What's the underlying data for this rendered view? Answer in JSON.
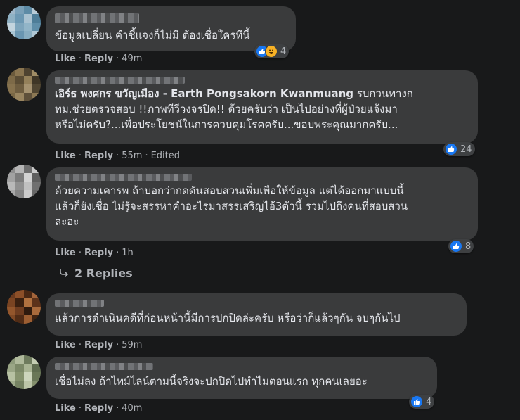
{
  "comments": [
    {
      "name": "",
      "text": "ข้อมูลเปลี่ยน คำชี้แจงก็ไม่มี ต้องเชื่อใครทีนี้",
      "like": "Like",
      "reply": "Reply",
      "time": "49m",
      "edited": "",
      "reactions": {
        "count": "4",
        "types": [
          "like",
          "haha"
        ]
      },
      "avatar_colors": [
        "#9fb7c9",
        "#7aa0b8",
        "#5d8ba6",
        "#b7cad6",
        "#8fb1c4",
        "#6c98b3",
        "#a9c2d1",
        "#4e7d98",
        "#c3d4de",
        "#7ea5bc",
        "#92b5c8",
        "#5f8ea9",
        "#aac5d4",
        "#6a96b1",
        "#88adc1",
        "#b0c8d6"
      ]
    },
    {
      "name_bold": "เอิร์ธ พงศกร ขวัญเมือง - Earth Pongsakorn Kwanmuang",
      "text_rest": " รบกวนทางก\nทม.ช่วยตรวจสอบ !!ภาพทีวีวงจรปิด!! ด้วยครับว่า เป็นไปอย่างที่ผู้ป่วยแจ้งมา\nหรือไม่ครับ?...เพื่อประโยชน์ในการควบคุมโรคครับ...ขอบพระคุณมากครับ...",
      "like": "Like",
      "reply": "Reply",
      "time": "55m",
      "edited": "Edited",
      "reactions": {
        "count": "24",
        "types": [
          "like"
        ]
      },
      "avatar_colors": [
        "#6b5a3c",
        "#8a7550",
        "#4f4330",
        "#a08c64",
        "#7d6a48",
        "#5b4d35",
        "#94805a",
        "#3f3626",
        "#86724e",
        "#6e5d40",
        "#a59270",
        "#514632",
        "#7a6846",
        "#998560",
        "#5e503a",
        "#8c7854"
      ]
    },
    {
      "name": "",
      "text": "ด้วยความเคารพ ถ้าบอกว่ากดดันสอบสวนเพิ่มเพื่อให้ข้อมูล แต่ได้ออกมาแบบนี้\nแล้วก็ยังเชื่อ ไม่รู้จะสรรหาคำอะไรมาสรรเสริญไอ้3ตัวนี้ รวมไปถึงคนที่สอบสวน\nละอะ",
      "like": "Like",
      "reply": "Reply",
      "time": "1h",
      "edited": "",
      "reactions": {
        "count": "8",
        "types": [
          "like"
        ]
      },
      "replies_label": "2 Replies",
      "avatar_colors": [
        "#8e8e8e",
        "#b5b5b5",
        "#6f6f6f",
        "#c9c9c9",
        "#a2a2a2",
        "#7c7c7c",
        "#d2d2d2",
        "#5e5e5e",
        "#b9b9b9",
        "#909090",
        "#c0c0c0",
        "#707070",
        "#a8a8a8",
        "#858585",
        "#cccccc",
        "#676767"
      ]
    },
    {
      "name": "",
      "text": "แล้วการดำเนินคดีที่ก่อนหน้านี้มีการปกปิดล่ะครับ หรือว่าก็แล้วๆกัน จบๆกันไป",
      "like": "Like",
      "reply": "Reply",
      "time": "59m",
      "edited": "",
      "reactions": {
        "count": "",
        "types": []
      },
      "avatar_colors": [
        "#6a3a1e",
        "#8c4f28",
        "#4a2814",
        "#a3643a",
        "#7a4422",
        "#3a2010",
        "#b0713f",
        "#5c321a",
        "#93562c",
        "#6f3d20",
        "#2e1a0e",
        "#a86a3c",
        "#7f4824",
        "#512c16",
        "#9c5e32",
        "#3f2312"
      ]
    },
    {
      "name": "",
      "text": "เชื่อไม่ลง ถ้าไทม์ไลน์ตามนี้จริงจะปกปิดไปทำไมตอนแรก ทุกคนเลยอะ",
      "like": "Like",
      "reply": "Reply",
      "time": "40m",
      "edited": "",
      "reactions": {
        "count": "4",
        "types": [
          "like"
        ]
      },
      "avatar_colors": [
        "#8d9a7a",
        "#b0ba9c",
        "#6e7b5d",
        "#c4cdb2",
        "#9aa686",
        "#7c8968",
        "#a9b494",
        "#5f6c50",
        "#b7c1a3",
        "#86936f",
        "#cdd5bd",
        "#6a7758",
        "#a0ac8c",
        "#758262",
        "#bcc5a8",
        "#838f6c"
      ]
    }
  ]
}
